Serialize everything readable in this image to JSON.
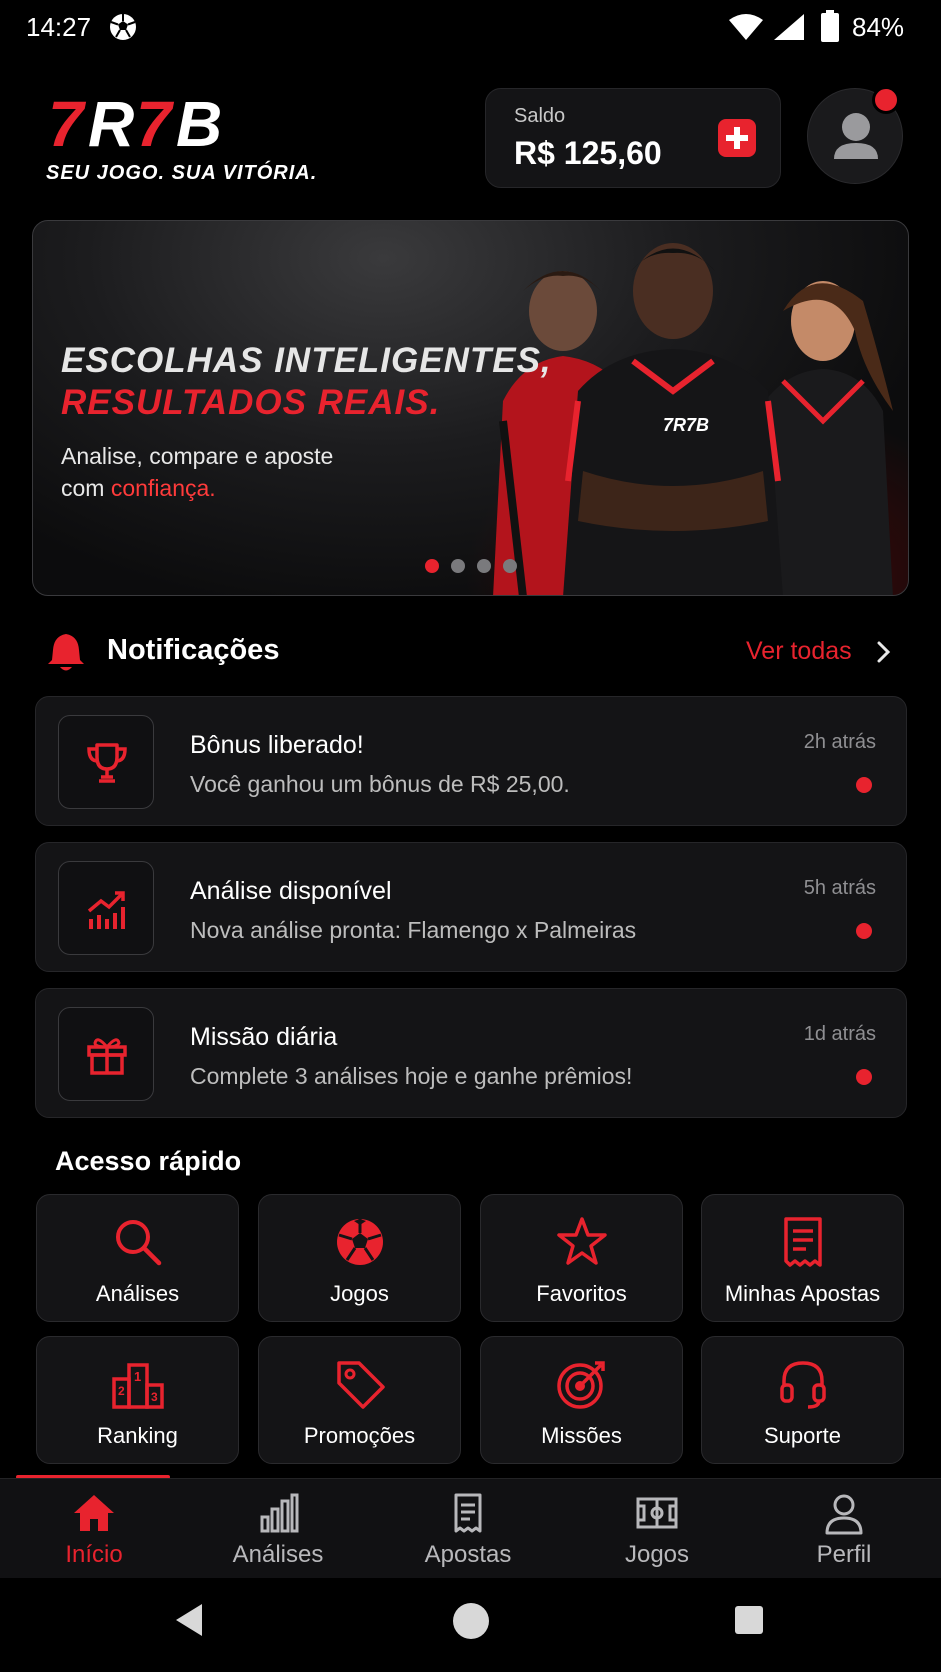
{
  "status_bar": {
    "time": "14:27",
    "battery_percent": "84%",
    "icons": [
      "soccer-ball-icon",
      "wifi-icon",
      "signal-icon",
      "battery-icon"
    ]
  },
  "header": {
    "brand": "7R7B",
    "slogan": "SEU JOGO. SUA VITÓRIA.",
    "balance_label": "Saldo",
    "balance_value": "R$ 125,60"
  },
  "banner": {
    "headline_1": "ESCOLHAS INTELIGENTES,",
    "headline_2": "RESULTADOS REAIS.",
    "text_1": "Analise, compare e aposte",
    "text_2_prefix": "com ",
    "text_2_highlight": "confiança.",
    "slides_total": 4,
    "active_slide": 1
  },
  "notifications": {
    "title": "Notificações",
    "see_all": "Ver todas",
    "items": [
      {
        "icon": "trophy-icon",
        "title": "Bônus liberado!",
        "subtitle": "Você ganhou um bônus de R$ 25,00.",
        "time": "2h atrás",
        "unread": true
      },
      {
        "icon": "chart-up-icon",
        "title": "Análise disponível",
        "subtitle": "Nova análise pronta: Flamengo x Palmeiras",
        "time": "5h atrás",
        "unread": true
      },
      {
        "icon": "gift-icon",
        "title": "Missão diária",
        "subtitle": "Complete 3 análises hoje e ganhe prêmios!",
        "time": "1d atrás",
        "unread": true
      }
    ]
  },
  "quick_access": {
    "title": "Acesso rápido",
    "tiles": [
      {
        "icon": "search-icon",
        "label": "Análises"
      },
      {
        "icon": "soccer-ball-icon",
        "label": "Jogos"
      },
      {
        "icon": "star-icon",
        "label": "Favoritos"
      },
      {
        "icon": "receipt-icon",
        "label": "Minhas Apostas"
      },
      {
        "icon": "podium-icon",
        "label": "Ranking"
      },
      {
        "icon": "tag-icon",
        "label": "Promoções"
      },
      {
        "icon": "target-icon",
        "label": "Missões"
      },
      {
        "icon": "headset-icon",
        "label": "Suporte"
      }
    ]
  },
  "bottom_nav": {
    "active": "Início",
    "items": [
      {
        "icon": "home-icon",
        "label": "Início"
      },
      {
        "icon": "bar-chart-icon",
        "label": "Análises"
      },
      {
        "icon": "ticket-icon",
        "label": "Apostas"
      },
      {
        "icon": "field-icon",
        "label": "Jogos"
      },
      {
        "icon": "user-icon",
        "label": "Perfil"
      }
    ]
  },
  "system_nav": {
    "icons": [
      "back-icon",
      "home-circle-icon",
      "recents-icon"
    ]
  },
  "colors": {
    "accent": "#e8232e",
    "background": "#000000",
    "card": "#141416"
  }
}
